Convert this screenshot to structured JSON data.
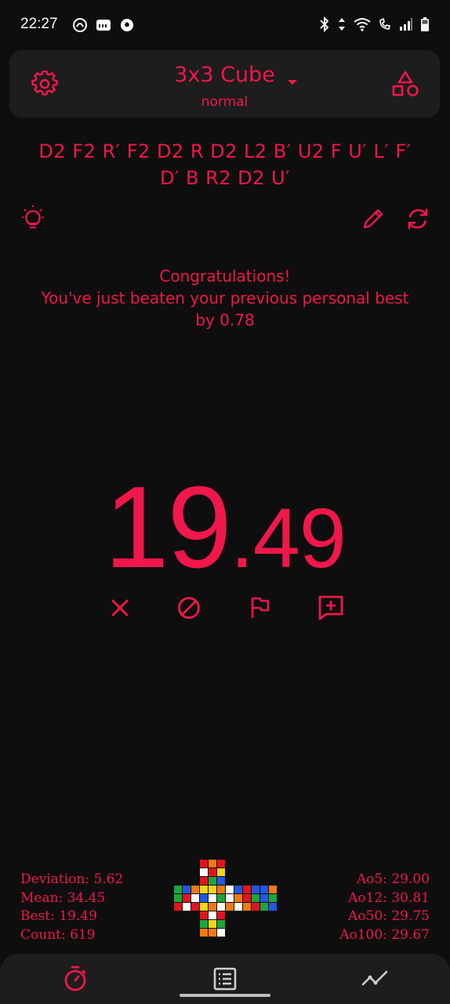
{
  "status_bar": {
    "time": "22:27",
    "left_icons": [
      "notification-app-icon",
      "ifttt-icon",
      "soccer-ball-icon"
    ],
    "right_icons": [
      "bluetooth-icon",
      "data-arrows-icon",
      "wifi-icon",
      "wifi-calling-icon",
      "signal-icon",
      "battery-icon"
    ]
  },
  "header": {
    "title": "3x3 Cube",
    "subtitle": "normal",
    "left_icon": "gear-icon",
    "right_icon": "shapes-icon"
  },
  "scramble": {
    "line1": "D2 F2 R′ F2 D2 R D2 L2 B′ U2 F U′ L′ F′",
    "line2": "D′ B R2 D2 U′"
  },
  "toolbar_icons": [
    "lightbulb-icon",
    "pencil-icon",
    "refresh-icon"
  ],
  "message": {
    "line1": "Congratulations!",
    "line2": "You've just beaten your previous personal best",
    "line3": "by 0.78"
  },
  "timer": {
    "seconds": "19",
    "fraction": ".49"
  },
  "actions": [
    "delete-icon",
    "dnf-icon",
    "flag-icon",
    "add-comment-icon"
  ],
  "stats": {
    "deviation": "Deviation: 5.62",
    "mean": "Mean: 34.45",
    "best": "Best: 19.49",
    "count": "Count: 619",
    "ao5": "Ao5: 29.00",
    "ao12": "Ao12: 30.81",
    "ao50": "Ao50: 29.75",
    "ao100": "Ao100: 29.67"
  },
  "cube_colors": {
    "W": "#ffffff",
    "Y": "#f5d515",
    "R": "#e3141e",
    "O": "#f07a10",
    "G": "#1ea53a",
    "B": "#2058e0"
  },
  "cube_faces": {
    "U": [
      "R",
      "O",
      "R",
      "W",
      "R",
      "Y",
      "R",
      "G",
      "B"
    ],
    "L": [
      "G",
      "B",
      "O",
      "G",
      "R",
      "W",
      "R",
      "W",
      "R"
    ],
    "F": [
      "Y",
      "Y",
      "O",
      "B",
      "W",
      "G",
      "Y",
      "O",
      "W"
    ],
    "R": [
      "W",
      "B",
      "R",
      "W",
      "O",
      "R",
      "O",
      "W",
      "O"
    ],
    "B": [
      "B",
      "B",
      "O",
      "G",
      "B",
      "G",
      "R",
      "G",
      "B"
    ],
    "D": [
      "R",
      "W",
      "R",
      "G",
      "Y",
      "G",
      "O",
      "O",
      "W"
    ]
  },
  "accent_color": "#f0174a",
  "nav_items": [
    "timer-icon",
    "list-icon",
    "chart-line-icon"
  ],
  "nav_active": "timer-icon"
}
